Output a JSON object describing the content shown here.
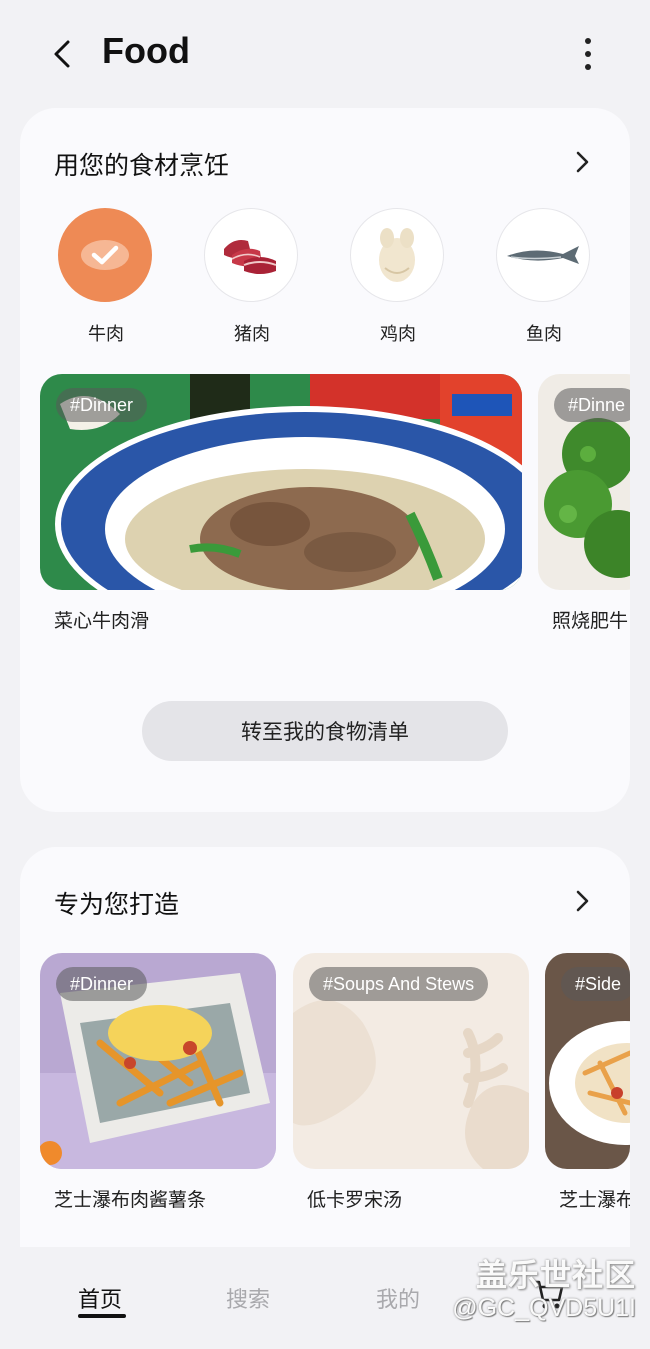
{
  "header": {
    "title": "Food",
    "back_icon": "back-arrow-icon",
    "more_icon": "more-vertical-icon"
  },
  "cook_section": {
    "title": "用您的食材烹饪",
    "ingredients": [
      {
        "label": "牛肉",
        "selected": true,
        "icon": "check-icon"
      },
      {
        "label": "猪肉",
        "selected": false,
        "icon": "pork-meat-icon"
      },
      {
        "label": "鸡肉",
        "selected": false,
        "icon": "whole-chicken-icon"
      },
      {
        "label": "鱼肉",
        "selected": false,
        "icon": "fish-icon"
      }
    ],
    "recipes": [
      {
        "tag": "#Dinner",
        "name": "菜心牛肉滑"
      },
      {
        "tag": "#Dinne",
        "name": "照烧肥牛"
      }
    ],
    "food_list_button": "转至我的食物清单"
  },
  "made_for_you": {
    "title": "专为您打造",
    "recipes": [
      {
        "tag": "#Dinner",
        "name": "芝士瀑布肉酱薯条"
      },
      {
        "tag": "#Soups And Stews",
        "name": "低卡罗宋汤"
      },
      {
        "tag": "#Side",
        "name": "芝士瀑布"
      }
    ]
  },
  "bottom_nav": {
    "items": [
      {
        "label": "首页",
        "active": true
      },
      {
        "label": "搜索",
        "active": false
      },
      {
        "label": "我的",
        "active": false
      }
    ],
    "cart_icon": "shopping-cart-icon"
  },
  "watermark": {
    "line1": "盖乐世社区",
    "line2": "@GC_QVD5U1I"
  },
  "colors": {
    "accent": "#ee8a55",
    "background": "#f2f2f5",
    "card": "#fafafd"
  }
}
